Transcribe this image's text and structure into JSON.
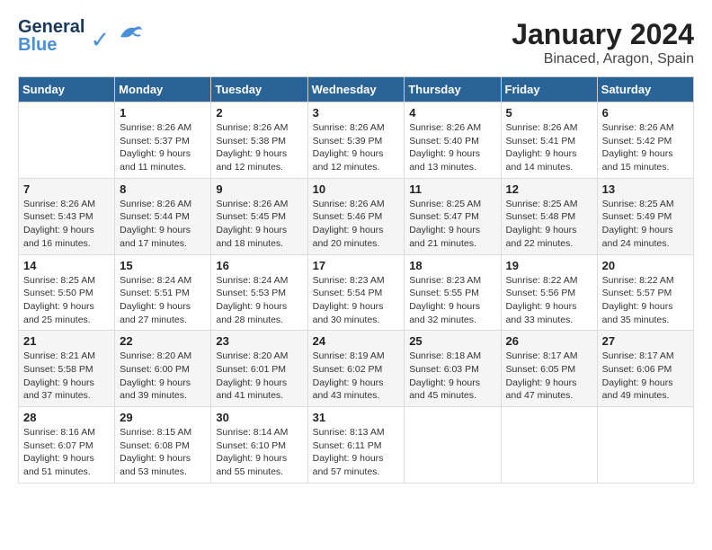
{
  "logo": {
    "line1": "General",
    "line2": "Blue"
  },
  "title": "January 2024",
  "subtitle": "Binaced, Aragon, Spain",
  "days_of_week": [
    "Sunday",
    "Monday",
    "Tuesday",
    "Wednesday",
    "Thursday",
    "Friday",
    "Saturday"
  ],
  "weeks": [
    [
      null,
      {
        "date": "1",
        "sunrise": "8:26 AM",
        "sunset": "5:37 PM",
        "daylight": "9 hours and 11 minutes."
      },
      {
        "date": "2",
        "sunrise": "8:26 AM",
        "sunset": "5:38 PM",
        "daylight": "9 hours and 12 minutes."
      },
      {
        "date": "3",
        "sunrise": "8:26 AM",
        "sunset": "5:39 PM",
        "daylight": "9 hours and 12 minutes."
      },
      {
        "date": "4",
        "sunrise": "8:26 AM",
        "sunset": "5:40 PM",
        "daylight": "9 hours and 13 minutes."
      },
      {
        "date": "5",
        "sunrise": "8:26 AM",
        "sunset": "5:41 PM",
        "daylight": "9 hours and 14 minutes."
      },
      {
        "date": "6",
        "sunrise": "8:26 AM",
        "sunset": "5:42 PM",
        "daylight": "9 hours and 15 minutes."
      }
    ],
    [
      {
        "date": "7",
        "sunrise": "8:26 AM",
        "sunset": "5:43 PM",
        "daylight": "9 hours and 16 minutes."
      },
      {
        "date": "8",
        "sunrise": "8:26 AM",
        "sunset": "5:44 PM",
        "daylight": "9 hours and 17 minutes."
      },
      {
        "date": "9",
        "sunrise": "8:26 AM",
        "sunset": "5:45 PM",
        "daylight": "9 hours and 18 minutes."
      },
      {
        "date": "10",
        "sunrise": "8:26 AM",
        "sunset": "5:46 PM",
        "daylight": "9 hours and 20 minutes."
      },
      {
        "date": "11",
        "sunrise": "8:25 AM",
        "sunset": "5:47 PM",
        "daylight": "9 hours and 21 minutes."
      },
      {
        "date": "12",
        "sunrise": "8:25 AM",
        "sunset": "5:48 PM",
        "daylight": "9 hours and 22 minutes."
      },
      {
        "date": "13",
        "sunrise": "8:25 AM",
        "sunset": "5:49 PM",
        "daylight": "9 hours and 24 minutes."
      }
    ],
    [
      {
        "date": "14",
        "sunrise": "8:25 AM",
        "sunset": "5:50 PM",
        "daylight": "9 hours and 25 minutes."
      },
      {
        "date": "15",
        "sunrise": "8:24 AM",
        "sunset": "5:51 PM",
        "daylight": "9 hours and 27 minutes."
      },
      {
        "date": "16",
        "sunrise": "8:24 AM",
        "sunset": "5:53 PM",
        "daylight": "9 hours and 28 minutes."
      },
      {
        "date": "17",
        "sunrise": "8:23 AM",
        "sunset": "5:54 PM",
        "daylight": "9 hours and 30 minutes."
      },
      {
        "date": "18",
        "sunrise": "8:23 AM",
        "sunset": "5:55 PM",
        "daylight": "9 hours and 32 minutes."
      },
      {
        "date": "19",
        "sunrise": "8:22 AM",
        "sunset": "5:56 PM",
        "daylight": "9 hours and 33 minutes."
      },
      {
        "date": "20",
        "sunrise": "8:22 AM",
        "sunset": "5:57 PM",
        "daylight": "9 hours and 35 minutes."
      }
    ],
    [
      {
        "date": "21",
        "sunrise": "8:21 AM",
        "sunset": "5:58 PM",
        "daylight": "9 hours and 37 minutes."
      },
      {
        "date": "22",
        "sunrise": "8:20 AM",
        "sunset": "6:00 PM",
        "daylight": "9 hours and 39 minutes."
      },
      {
        "date": "23",
        "sunrise": "8:20 AM",
        "sunset": "6:01 PM",
        "daylight": "9 hours and 41 minutes."
      },
      {
        "date": "24",
        "sunrise": "8:19 AM",
        "sunset": "6:02 PM",
        "daylight": "9 hours and 43 minutes."
      },
      {
        "date": "25",
        "sunrise": "8:18 AM",
        "sunset": "6:03 PM",
        "daylight": "9 hours and 45 minutes."
      },
      {
        "date": "26",
        "sunrise": "8:17 AM",
        "sunset": "6:05 PM",
        "daylight": "9 hours and 47 minutes."
      },
      {
        "date": "27",
        "sunrise": "8:17 AM",
        "sunset": "6:06 PM",
        "daylight": "9 hours and 49 minutes."
      }
    ],
    [
      {
        "date": "28",
        "sunrise": "8:16 AM",
        "sunset": "6:07 PM",
        "daylight": "9 hours and 51 minutes."
      },
      {
        "date": "29",
        "sunrise": "8:15 AM",
        "sunset": "6:08 PM",
        "daylight": "9 hours and 53 minutes."
      },
      {
        "date": "30",
        "sunrise": "8:14 AM",
        "sunset": "6:10 PM",
        "daylight": "9 hours and 55 minutes."
      },
      {
        "date": "31",
        "sunrise": "8:13 AM",
        "sunset": "6:11 PM",
        "daylight": "9 hours and 57 minutes."
      },
      null,
      null,
      null
    ]
  ]
}
